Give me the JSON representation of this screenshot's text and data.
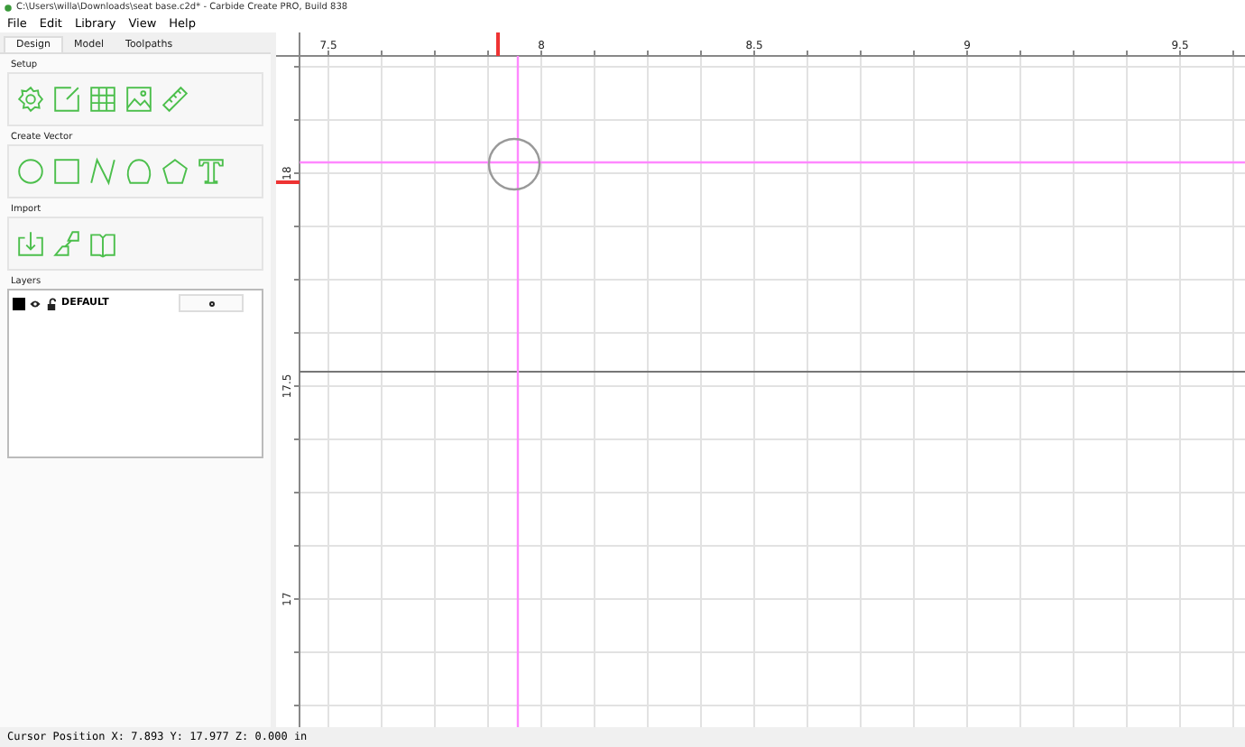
{
  "window": {
    "title": "C:\\Users\\willa\\Downloads\\seat base.c2d* - Carbide Create PRO, Build 838"
  },
  "menu": [
    "File",
    "Edit",
    "Library",
    "View",
    "Help"
  ],
  "tabs": [
    {
      "label": "Design",
      "selected": true
    },
    {
      "label": "Model",
      "selected": false
    },
    {
      "label": "Toolpaths",
      "selected": false
    }
  ],
  "sections": [
    {
      "title": "Setup"
    },
    {
      "title": "Create Vector"
    },
    {
      "title": "Import"
    }
  ],
  "layers": {
    "title": "Layers",
    "items": [
      {
        "name": "DEFAULT"
      }
    ]
  },
  "canvas": {
    "x_labels": [
      "7.5",
      "8",
      "8.5",
      "9",
      "9.5"
    ],
    "y_labels": [
      "18",
      "17.5",
      "17"
    ]
  },
  "status_bar": "Cursor Position X: 7.893 Y: 17.977 Z: 0.000 in"
}
